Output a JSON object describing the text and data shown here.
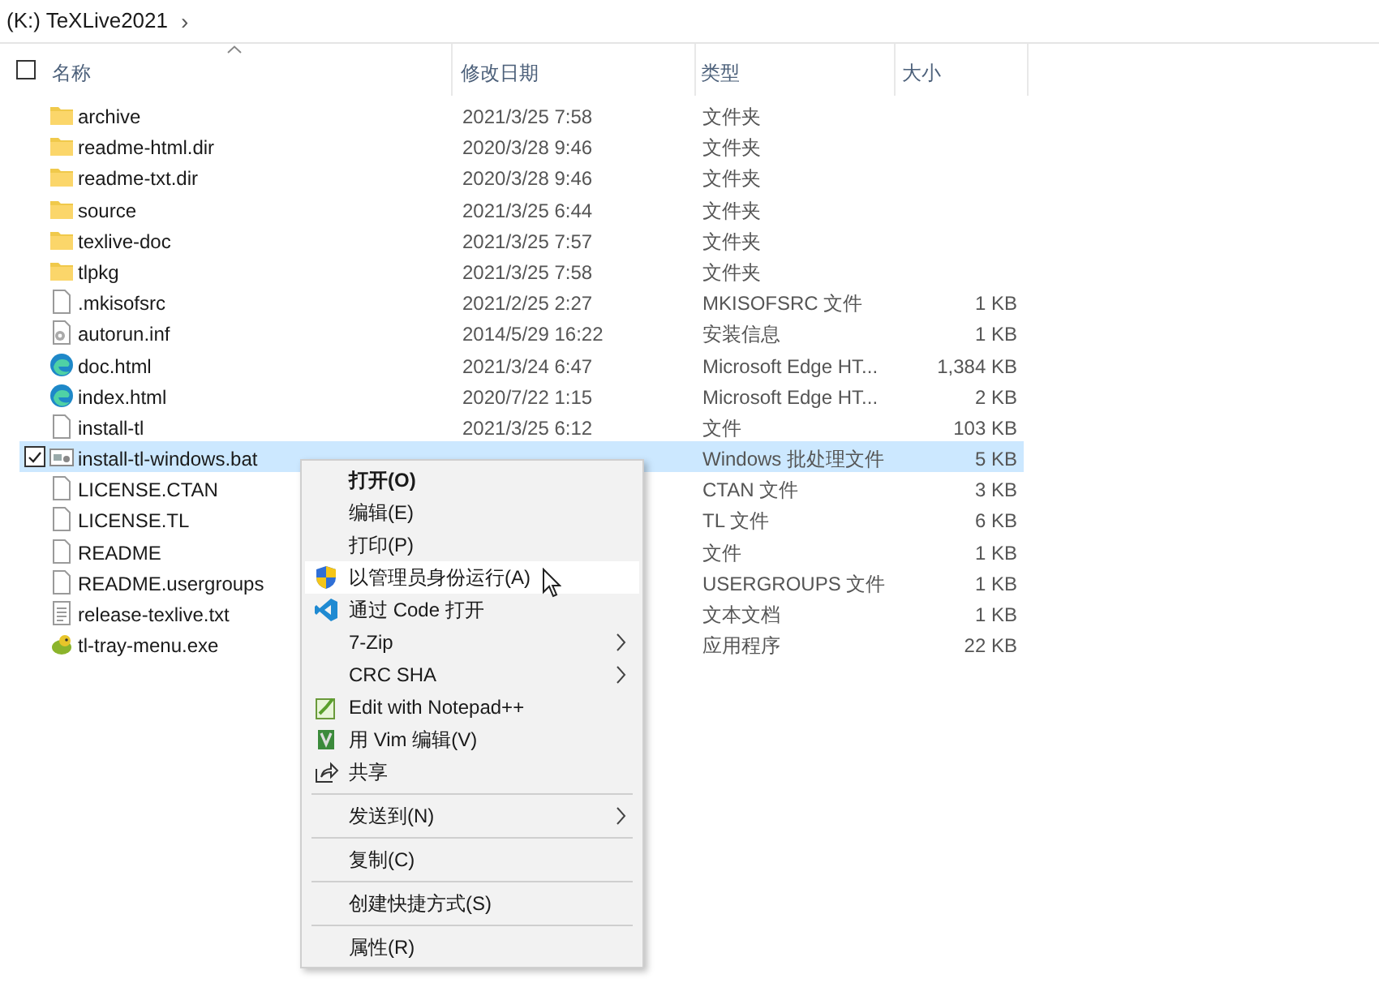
{
  "breadcrumb": {
    "path": "(K:) TeXLive2021",
    "chevron": "›"
  },
  "select_all": {
    "checked": false
  },
  "columns": [
    {
      "label": "名称",
      "sorted": true
    },
    {
      "label": "修改日期",
      "sorted": false
    },
    {
      "label": "类型",
      "sorted": false
    },
    {
      "label": "大小",
      "sorted": false
    }
  ],
  "files": [
    {
      "name": "archive",
      "kind": "folder",
      "date": "2021/3/25 7:58",
      "type": "文件夹",
      "selected": false,
      "checked": false
    },
    {
      "name": "readme-html.dir",
      "kind": "folder",
      "date": "2020/3/28 9:46",
      "type": "文件夹",
      "selected": false,
      "checked": false
    },
    {
      "name": "readme-txt.dir",
      "kind": "folder",
      "date": "2020/3/28 9:46",
      "type": "文件夹",
      "selected": false,
      "checked": false
    },
    {
      "name": "source",
      "kind": "folder",
      "date": "2021/3/25 6:44",
      "type": "文件夹",
      "selected": false,
      "checked": false
    },
    {
      "name": "texlive-doc",
      "kind": "folder",
      "date": "2021/3/25 7:57",
      "type": "文件夹",
      "selected": false,
      "checked": false
    },
    {
      "name": "tlpkg",
      "kind": "folder",
      "date": "2021/3/25 7:58",
      "type": "文件夹",
      "selected": false,
      "checked": false
    },
    {
      "name": ".mkisofsrc",
      "kind": "file",
      "date": "2021/2/25 2:27",
      "type": "MKISOFSRC 文件",
      "size": "1 KB",
      "selected": false,
      "checked": false
    },
    {
      "name": "autorun.inf",
      "kind": "settings-file",
      "date": "2014/5/29 16:22",
      "type": "安装信息",
      "size": "1 KB",
      "selected": false,
      "checked": false
    },
    {
      "name": "doc.html",
      "kind": "browser",
      "date": "2021/3/24 6:47",
      "type": "Microsoft Edge HT...",
      "size": "1,384 KB",
      "selected": false,
      "checked": false
    },
    {
      "name": "index.html",
      "kind": "browser",
      "date": "2020/7/22 1:15",
      "type": "Microsoft Edge HT...",
      "size": "2 KB",
      "selected": false,
      "checked": false
    },
    {
      "name": "install-tl",
      "kind": "file",
      "date": "2021/3/25 6:12",
      "type": "文件",
      "size": "103 KB",
      "selected": false,
      "checked": false
    },
    {
      "name": "install-tl-windows.bat",
      "kind": "batch",
      "type": "Windows 批处理文件",
      "size": "5 KB",
      "selected": true,
      "checked": true
    },
    {
      "name": "LICENSE.CTAN",
      "kind": "file",
      "type": "CTAN 文件",
      "size": "3 KB",
      "selected": false,
      "checked": false
    },
    {
      "name": "LICENSE.TL",
      "kind": "file",
      "type": "TL 文件",
      "size": "6 KB",
      "selected": false,
      "checked": false
    },
    {
      "name": "README",
      "kind": "file",
      "type": "文件",
      "size": "1 KB",
      "selected": false,
      "checked": false
    },
    {
      "name": "README.usergroups",
      "kind": "file",
      "type": "USERGROUPS 文件",
      "size": "1 KB",
      "selected": false,
      "checked": false
    },
    {
      "name": "release-texlive.txt",
      "kind": "text",
      "type": "文本文档",
      "size": "1 KB",
      "selected": false,
      "checked": false
    },
    {
      "name": "tl-tray-menu.exe",
      "kind": "app",
      "type": "应用程序",
      "size": "22 KB",
      "selected": false,
      "checked": false
    }
  ],
  "context_menu": [
    {
      "kind": "plain",
      "label": "打开(O)",
      "bold": true,
      "submenu": false,
      "selected": false
    },
    {
      "kind": "plain",
      "label": "编辑(E)",
      "bold": false,
      "submenu": false,
      "selected": false
    },
    {
      "kind": "plain",
      "label": "打印(P)",
      "bold": false,
      "submenu": false,
      "selected": false
    },
    {
      "kind": "shield",
      "label": "以管理员身份运行(A)",
      "bold": false,
      "submenu": false,
      "selected": true
    },
    {
      "kind": "code",
      "label": "通过 Code 打开",
      "bold": false,
      "submenu": false,
      "selected": false
    },
    {
      "kind": "plain",
      "label": "7-Zip",
      "bold": false,
      "submenu": true,
      "selected": false
    },
    {
      "kind": "plain",
      "label": "CRC SHA",
      "bold": false,
      "submenu": true,
      "selected": false
    },
    {
      "kind": "notepad",
      "label": "Edit with Notepad++",
      "bold": false,
      "submenu": false,
      "selected": false
    },
    {
      "kind": "vim",
      "label": "用 Vim 编辑(V)",
      "bold": false,
      "submenu": false,
      "selected": false
    },
    {
      "kind": "share",
      "label": "共享",
      "bold": false,
      "submenu": false,
      "selected": false
    },
    {
      "kind": "separator"
    },
    {
      "kind": "plain",
      "label": "发送到(N)",
      "bold": false,
      "submenu": true,
      "selected": false
    },
    {
      "kind": "separator"
    },
    {
      "kind": "plain",
      "label": "复制(C)",
      "bold": false,
      "submenu": false,
      "selected": false
    },
    {
      "kind": "separator"
    },
    {
      "kind": "plain",
      "label": "创建快捷方式(S)",
      "bold": false,
      "submenu": false,
      "selected": false
    },
    {
      "kind": "separator"
    },
    {
      "kind": "plain",
      "label": "属性(R)",
      "bold": false,
      "submenu": false,
      "selected": false
    }
  ]
}
